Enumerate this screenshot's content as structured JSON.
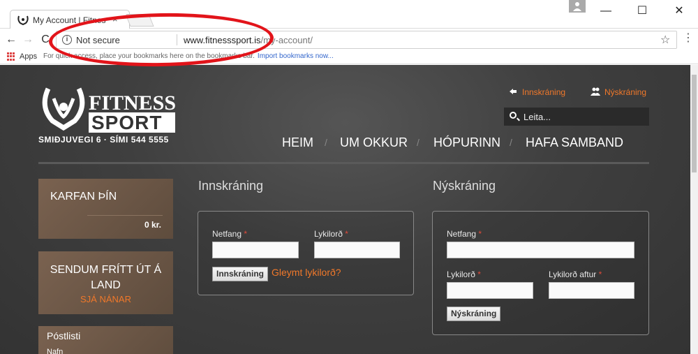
{
  "browser": {
    "tab_title": "My Account | Fitness...",
    "tab_close": "×",
    "window": {
      "minimize": "—",
      "maximize": "☐",
      "close": "✕"
    },
    "nav": {
      "back": "←",
      "forward": "→",
      "reload": "C"
    },
    "security_label": "Not secure",
    "url_host": "www.fitnesssport.is",
    "url_path": "/my-account/",
    "bookmark_star": "☆",
    "menu": "⋮",
    "bookmarks_bar": {
      "apps_label": "Apps",
      "hint": "For quick access, place your bookmarks here on the bookmarks bar.",
      "import_link": "Import bookmarks now..."
    }
  },
  "site": {
    "logo": {
      "word1": "FITNESS",
      "word2": "SPORT",
      "address": "SMIÐJUVEGI 6 · SÍMI 544 5555"
    },
    "top_links": {
      "login": "Innskráning",
      "register": "Nýskráning"
    },
    "search": {
      "placeholder": "Leita..."
    },
    "main_nav": [
      "HEIM",
      "UM OKKUR",
      "HÓPURINN",
      "HAFA SAMBAND"
    ],
    "nav_separator": "/",
    "sidebar": {
      "cart": {
        "title": "KARFAN ÞÍN",
        "total": "0 kr."
      },
      "shipping": {
        "title": "SENDUM FRÍTT ÚT Á LAND",
        "link": "SJÁ NÁNAR"
      },
      "newsletter": {
        "title": "Póstlisti",
        "name_label": "Nafn"
      }
    },
    "login": {
      "title": "Innskráning",
      "email_label": "Netfang",
      "password_label": "Lykilorð",
      "required_mark": "*",
      "submit": "Innskráning",
      "forgot": "Gleymt lykilorð?"
    },
    "register": {
      "title": "Nýskráning",
      "email_label": "Netfang",
      "password_label": "Lykilorð",
      "password_again_label": "Lykilorð aftur",
      "required_mark": "*",
      "submit": "Nýskráning"
    }
  },
  "colors": {
    "accent": "#f0782a",
    "annotation": "#e2141a",
    "background": "#3d3d3d",
    "sidebox": "#6a5646"
  }
}
